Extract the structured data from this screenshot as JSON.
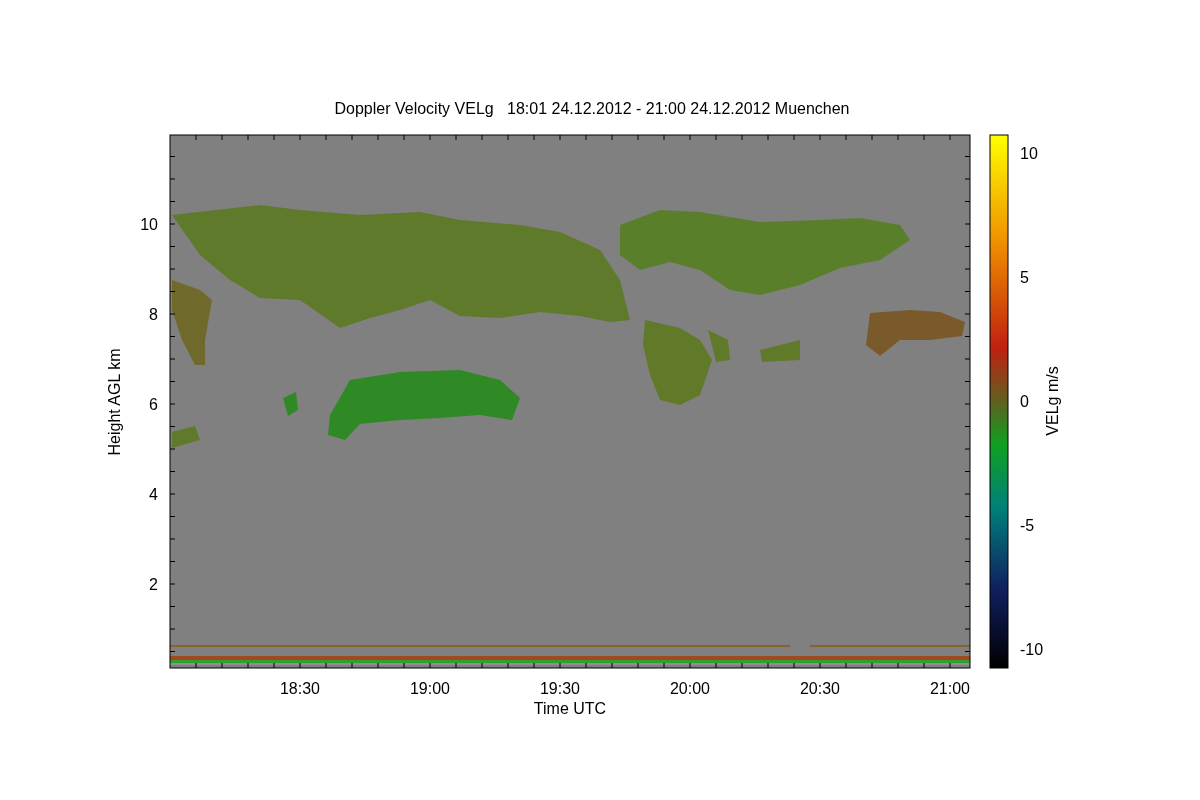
{
  "title": "Doppler Velocity VELg   18:01 24.12.2012 - 21:00 24.12.2012 Muenchen",
  "y_axis": {
    "label": "Height AGL km",
    "ticks": [
      "10",
      "8",
      "6",
      "4",
      "2"
    ]
  },
  "x_axis": {
    "label": "Time UTC",
    "ticks": [
      "18:30",
      "19:00",
      "19:30",
      "20:00",
      "20:30",
      "21:00"
    ]
  },
  "colorbar": {
    "label": "VELg m/s",
    "ticks": [
      "10",
      "5",
      "0",
      "-5",
      "-10"
    ]
  }
}
